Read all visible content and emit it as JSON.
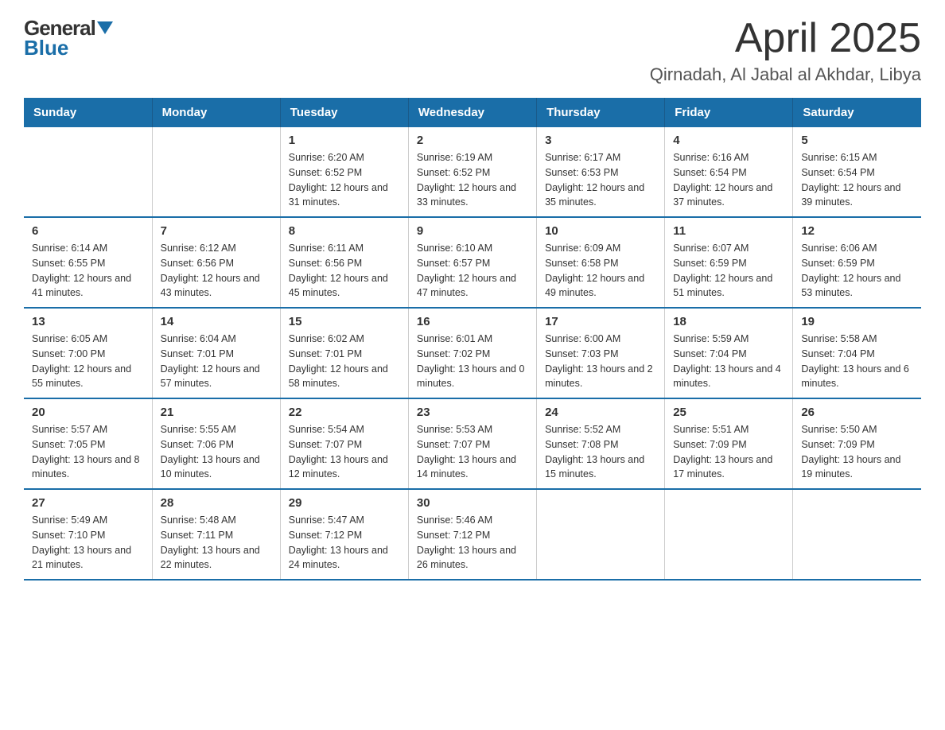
{
  "header": {
    "logo_general": "General",
    "logo_blue": "Blue",
    "title": "April 2025",
    "subtitle": "Qirnadah, Al Jabal al Akhdar, Libya"
  },
  "calendar": {
    "days_of_week": [
      "Sunday",
      "Monday",
      "Tuesday",
      "Wednesday",
      "Thursday",
      "Friday",
      "Saturday"
    ],
    "weeks": [
      [
        {
          "day": "",
          "sunrise": "",
          "sunset": "",
          "daylight": ""
        },
        {
          "day": "",
          "sunrise": "",
          "sunset": "",
          "daylight": ""
        },
        {
          "day": "1",
          "sunrise": "Sunrise: 6:20 AM",
          "sunset": "Sunset: 6:52 PM",
          "daylight": "Daylight: 12 hours and 31 minutes."
        },
        {
          "day": "2",
          "sunrise": "Sunrise: 6:19 AM",
          "sunset": "Sunset: 6:52 PM",
          "daylight": "Daylight: 12 hours and 33 minutes."
        },
        {
          "day": "3",
          "sunrise": "Sunrise: 6:17 AM",
          "sunset": "Sunset: 6:53 PM",
          "daylight": "Daylight: 12 hours and 35 minutes."
        },
        {
          "day": "4",
          "sunrise": "Sunrise: 6:16 AM",
          "sunset": "Sunset: 6:54 PM",
          "daylight": "Daylight: 12 hours and 37 minutes."
        },
        {
          "day": "5",
          "sunrise": "Sunrise: 6:15 AM",
          "sunset": "Sunset: 6:54 PM",
          "daylight": "Daylight: 12 hours and 39 minutes."
        }
      ],
      [
        {
          "day": "6",
          "sunrise": "Sunrise: 6:14 AM",
          "sunset": "Sunset: 6:55 PM",
          "daylight": "Daylight: 12 hours and 41 minutes."
        },
        {
          "day": "7",
          "sunrise": "Sunrise: 6:12 AM",
          "sunset": "Sunset: 6:56 PM",
          "daylight": "Daylight: 12 hours and 43 minutes."
        },
        {
          "day": "8",
          "sunrise": "Sunrise: 6:11 AM",
          "sunset": "Sunset: 6:56 PM",
          "daylight": "Daylight: 12 hours and 45 minutes."
        },
        {
          "day": "9",
          "sunrise": "Sunrise: 6:10 AM",
          "sunset": "Sunset: 6:57 PM",
          "daylight": "Daylight: 12 hours and 47 minutes."
        },
        {
          "day": "10",
          "sunrise": "Sunrise: 6:09 AM",
          "sunset": "Sunset: 6:58 PM",
          "daylight": "Daylight: 12 hours and 49 minutes."
        },
        {
          "day": "11",
          "sunrise": "Sunrise: 6:07 AM",
          "sunset": "Sunset: 6:59 PM",
          "daylight": "Daylight: 12 hours and 51 minutes."
        },
        {
          "day": "12",
          "sunrise": "Sunrise: 6:06 AM",
          "sunset": "Sunset: 6:59 PM",
          "daylight": "Daylight: 12 hours and 53 minutes."
        }
      ],
      [
        {
          "day": "13",
          "sunrise": "Sunrise: 6:05 AM",
          "sunset": "Sunset: 7:00 PM",
          "daylight": "Daylight: 12 hours and 55 minutes."
        },
        {
          "day": "14",
          "sunrise": "Sunrise: 6:04 AM",
          "sunset": "Sunset: 7:01 PM",
          "daylight": "Daylight: 12 hours and 57 minutes."
        },
        {
          "day": "15",
          "sunrise": "Sunrise: 6:02 AM",
          "sunset": "Sunset: 7:01 PM",
          "daylight": "Daylight: 12 hours and 58 minutes."
        },
        {
          "day": "16",
          "sunrise": "Sunrise: 6:01 AM",
          "sunset": "Sunset: 7:02 PM",
          "daylight": "Daylight: 13 hours and 0 minutes."
        },
        {
          "day": "17",
          "sunrise": "Sunrise: 6:00 AM",
          "sunset": "Sunset: 7:03 PM",
          "daylight": "Daylight: 13 hours and 2 minutes."
        },
        {
          "day": "18",
          "sunrise": "Sunrise: 5:59 AM",
          "sunset": "Sunset: 7:04 PM",
          "daylight": "Daylight: 13 hours and 4 minutes."
        },
        {
          "day": "19",
          "sunrise": "Sunrise: 5:58 AM",
          "sunset": "Sunset: 7:04 PM",
          "daylight": "Daylight: 13 hours and 6 minutes."
        }
      ],
      [
        {
          "day": "20",
          "sunrise": "Sunrise: 5:57 AM",
          "sunset": "Sunset: 7:05 PM",
          "daylight": "Daylight: 13 hours and 8 minutes."
        },
        {
          "day": "21",
          "sunrise": "Sunrise: 5:55 AM",
          "sunset": "Sunset: 7:06 PM",
          "daylight": "Daylight: 13 hours and 10 minutes."
        },
        {
          "day": "22",
          "sunrise": "Sunrise: 5:54 AM",
          "sunset": "Sunset: 7:07 PM",
          "daylight": "Daylight: 13 hours and 12 minutes."
        },
        {
          "day": "23",
          "sunrise": "Sunrise: 5:53 AM",
          "sunset": "Sunset: 7:07 PM",
          "daylight": "Daylight: 13 hours and 14 minutes."
        },
        {
          "day": "24",
          "sunrise": "Sunrise: 5:52 AM",
          "sunset": "Sunset: 7:08 PM",
          "daylight": "Daylight: 13 hours and 15 minutes."
        },
        {
          "day": "25",
          "sunrise": "Sunrise: 5:51 AM",
          "sunset": "Sunset: 7:09 PM",
          "daylight": "Daylight: 13 hours and 17 minutes."
        },
        {
          "day": "26",
          "sunrise": "Sunrise: 5:50 AM",
          "sunset": "Sunset: 7:09 PM",
          "daylight": "Daylight: 13 hours and 19 minutes."
        }
      ],
      [
        {
          "day": "27",
          "sunrise": "Sunrise: 5:49 AM",
          "sunset": "Sunset: 7:10 PM",
          "daylight": "Daylight: 13 hours and 21 minutes."
        },
        {
          "day": "28",
          "sunrise": "Sunrise: 5:48 AM",
          "sunset": "Sunset: 7:11 PM",
          "daylight": "Daylight: 13 hours and 22 minutes."
        },
        {
          "day": "29",
          "sunrise": "Sunrise: 5:47 AM",
          "sunset": "Sunset: 7:12 PM",
          "daylight": "Daylight: 13 hours and 24 minutes."
        },
        {
          "day": "30",
          "sunrise": "Sunrise: 5:46 AM",
          "sunset": "Sunset: 7:12 PM",
          "daylight": "Daylight: 13 hours and 26 minutes."
        },
        {
          "day": "",
          "sunrise": "",
          "sunset": "",
          "daylight": ""
        },
        {
          "day": "",
          "sunrise": "",
          "sunset": "",
          "daylight": ""
        },
        {
          "day": "",
          "sunrise": "",
          "sunset": "",
          "daylight": ""
        }
      ]
    ]
  }
}
